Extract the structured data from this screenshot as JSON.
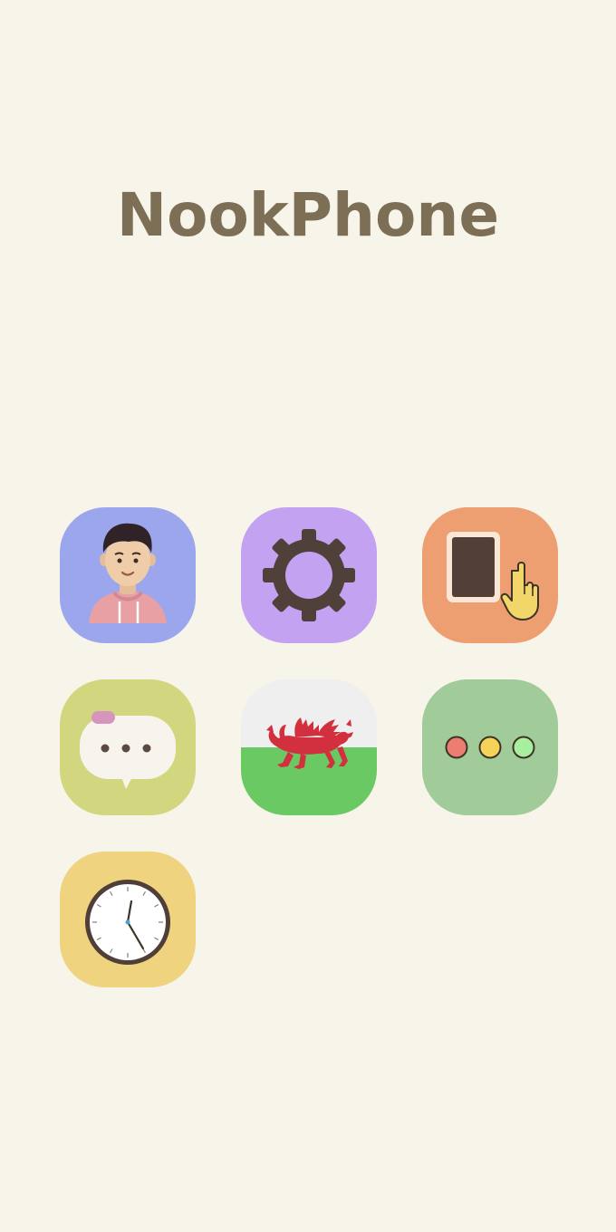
{
  "header": {
    "title": "NookPhone"
  },
  "colors": {
    "background": "#f7f4ea",
    "title": "#7d6f55",
    "profile_tile": "#9ba6ec",
    "settings_tile": "#c3a2f2",
    "device_tile": "#ee9f72",
    "chat_tile": "#d2d77f",
    "wales_tile": "#f0f0f0",
    "more_tile": "#a2cb9a",
    "clock_tile": "#efd37f"
  },
  "apps": [
    {
      "icon": "profile-avatar-icon"
    },
    {
      "icon": "gear-icon"
    },
    {
      "icon": "tablet-tap-icon"
    },
    {
      "icon": "chat-bubble-icon"
    },
    {
      "icon": "welsh-dragon-flag-icon"
    },
    {
      "icon": "three-dots-icon"
    },
    {
      "icon": "clock-icon"
    }
  ]
}
